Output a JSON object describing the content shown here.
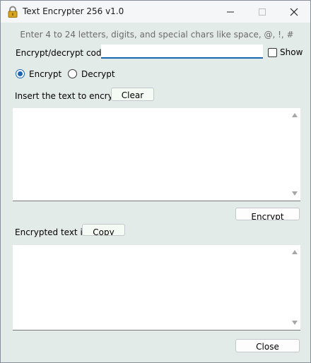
{
  "window": {
    "title": "Text Encrypter 256 v1.0",
    "icon": "padlock-icon",
    "controls": [
      "minimize-icon",
      "maximize-icon",
      "close-icon"
    ]
  },
  "hint": "Enter 4 to 24 letters, digits, and special chars like space, @, !,  #",
  "code": {
    "label": "Encrypt/decrypt code:",
    "value": "",
    "show_label": "Show",
    "show_checked": false
  },
  "mode": {
    "options": [
      {
        "label": "Encrypt",
        "selected": true
      },
      {
        "label": "Decrypt",
        "selected": false
      }
    ]
  },
  "input": {
    "label": "Insert the text to encrypt:",
    "clear_label": "Clear",
    "text": ""
  },
  "actions": {
    "encrypt_label": "Encrypt",
    "copy_label": "Copy",
    "close_label": "Close"
  },
  "output": {
    "label": "Encrypted text is:",
    "text": ""
  },
  "colors": {
    "window_bg": "#e3ebe8",
    "accent": "#1a66b3",
    "hint_text": "#6b6b6b"
  }
}
